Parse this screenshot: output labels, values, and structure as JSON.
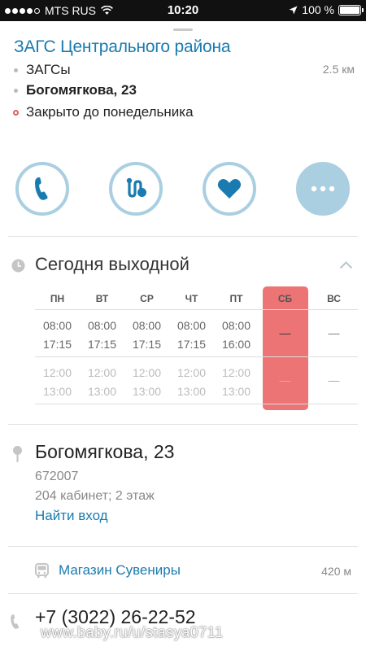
{
  "status_bar": {
    "carrier": "MTS RUS",
    "time": "10:20",
    "battery": "100 %",
    "battery_level": 1.0,
    "signal_bars": 4
  },
  "place": {
    "title": "ЗАГС Центрального района",
    "category": "ЗАГСы",
    "distance": "2.5 км",
    "address": "Богомягкова, 23",
    "status": "Закрыто до понедельника"
  },
  "actions": [
    {
      "name": "call-button",
      "icon": "phone-icon"
    },
    {
      "name": "route-button",
      "icon": "route-icon"
    },
    {
      "name": "favorite-button",
      "icon": "heart-icon"
    },
    {
      "name": "more-button",
      "icon": "more-icon"
    }
  ],
  "schedule": {
    "title": "Сегодня выходной",
    "days": [
      "ПН",
      "ВТ",
      "СР",
      "ЧТ",
      "ПТ",
      "СБ",
      "ВС"
    ],
    "hours": [
      [
        "08:00",
        "17:15"
      ],
      [
        "08:00",
        "17:15"
      ],
      [
        "08:00",
        "17:15"
      ],
      [
        "08:00",
        "17:15"
      ],
      [
        "08:00",
        "16:00"
      ],
      [
        "—"
      ],
      [
        "—"
      ]
    ],
    "breaks": [
      [
        "12:00",
        "13:00"
      ],
      [
        "12:00",
        "13:00"
      ],
      [
        "12:00",
        "13:00"
      ],
      [
        "12:00",
        "13:00"
      ],
      [
        "12:00",
        "13:00"
      ],
      [
        "—"
      ],
      [
        "—"
      ]
    ],
    "today_index": 5,
    "highlight_color": "#ec7475"
  },
  "address_block": {
    "street": "Богомягкова, 23",
    "postal_code": "672007",
    "room": "204 кабинет; 2 этаж",
    "find_entrance": "Найти вход"
  },
  "nearby": {
    "name": "Магазин Сувениры",
    "distance": "420 м"
  },
  "phone": "+7 (3022) 26-22-52",
  "watermark": "www.baby.ru/u/stasya0711",
  "colors": {
    "accent": "#1a7bb0",
    "action_ring": "#a9cfe1",
    "closed": "#e06060"
  }
}
